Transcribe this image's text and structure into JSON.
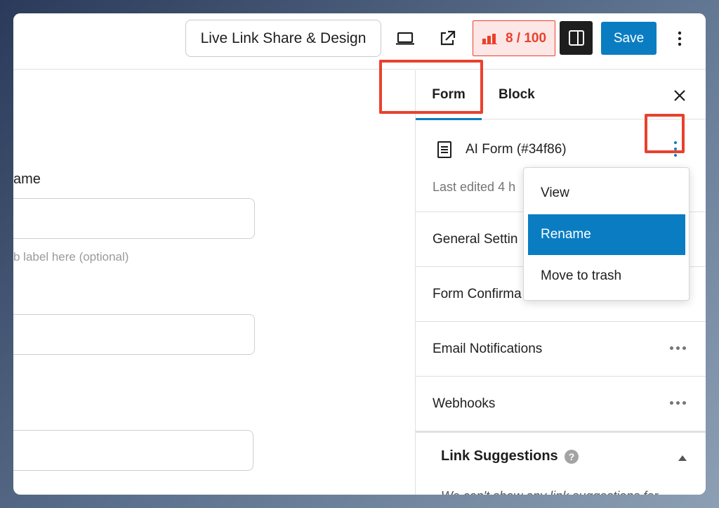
{
  "topbar": {
    "live_button": "Live Link Share & Design",
    "preview_icon": "laptop-icon",
    "external_icon": "external-link-icon",
    "score": "8 / 100",
    "score_icon": "chart-icon",
    "save_label": "Save"
  },
  "left": {
    "field_label": "ame",
    "helper_text": "b label here (optional)"
  },
  "sidebar": {
    "tabs": [
      {
        "label": "Form"
      },
      {
        "label": "Block"
      }
    ],
    "form_title": "AI Form (#34f86)",
    "last_edited": "Last edited 4 h",
    "rows": [
      {
        "label": "General Settin"
      },
      {
        "label": "Form Confirma"
      },
      {
        "label": "Email Notifications"
      },
      {
        "label": "Webhooks"
      }
    ],
    "link_suggestions": {
      "label": "Link Suggestions",
      "note": "We can't show any link suggestions for"
    }
  },
  "menu": {
    "items": [
      {
        "label": "View"
      },
      {
        "label": "Rename"
      },
      {
        "label": "Move to trash"
      }
    ]
  },
  "colors": {
    "accent": "#0a7dc2",
    "highlight": "#e9412c",
    "score_bg": "#fde6e6"
  }
}
